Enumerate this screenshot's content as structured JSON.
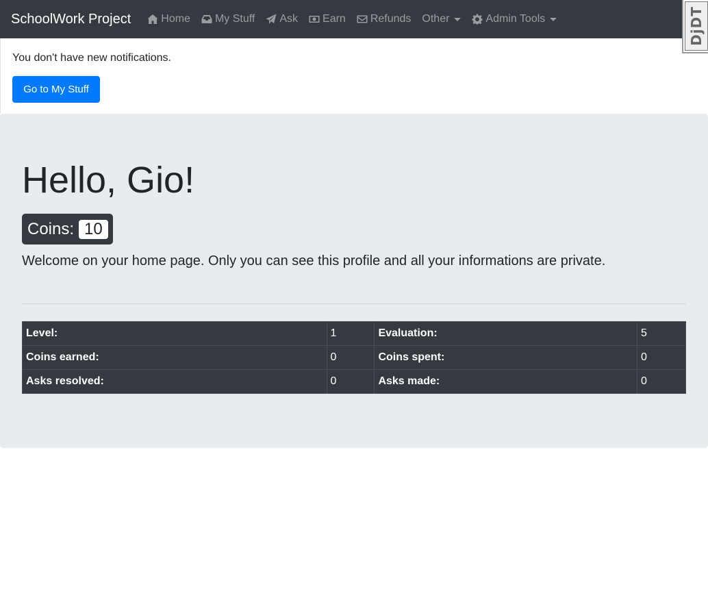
{
  "navbar": {
    "brand": "SchoolWork Project",
    "items": [
      {
        "label": "Home",
        "icon": "home-icon"
      },
      {
        "label": "My Stuff",
        "icon": "inbox-icon"
      },
      {
        "label": "Ask",
        "icon": "paper-plane-icon"
      },
      {
        "label": "Earn",
        "icon": "money-bill-icon"
      },
      {
        "label": "Refunds",
        "icon": "envelope-icon"
      },
      {
        "label": "Other",
        "icon": ""
      },
      {
        "label": "Admin Tools",
        "icon": "gear-icon"
      }
    ]
  },
  "debug_toolbar": {
    "label": "DjDT"
  },
  "notifications": {
    "message": "You don't have new notifications.",
    "button_label": "Go to My Stuff"
  },
  "profile": {
    "greeting": "Hello, Gio!",
    "coins_label": "Coins:",
    "coins_value": "10",
    "lead": "Welcome on your home page. Only you can see this profile and all your informations are private."
  },
  "stats": {
    "rows": [
      [
        {
          "label": "Level:",
          "value": "1"
        },
        {
          "label": "Evaluation:",
          "value": "5"
        }
      ],
      [
        {
          "label": "Coins earned:",
          "value": "0"
        },
        {
          "label": "Coins spent:",
          "value": "0"
        }
      ],
      [
        {
          "label": "Asks resolved:",
          "value": "0"
        },
        {
          "label": "Asks made:",
          "value": "0"
        }
      ]
    ]
  },
  "colors": {
    "navbar_bg": "#343a40",
    "primary": "#007bff",
    "jumbotron_bg": "#e9ecef",
    "table_bg": "#343a40"
  }
}
